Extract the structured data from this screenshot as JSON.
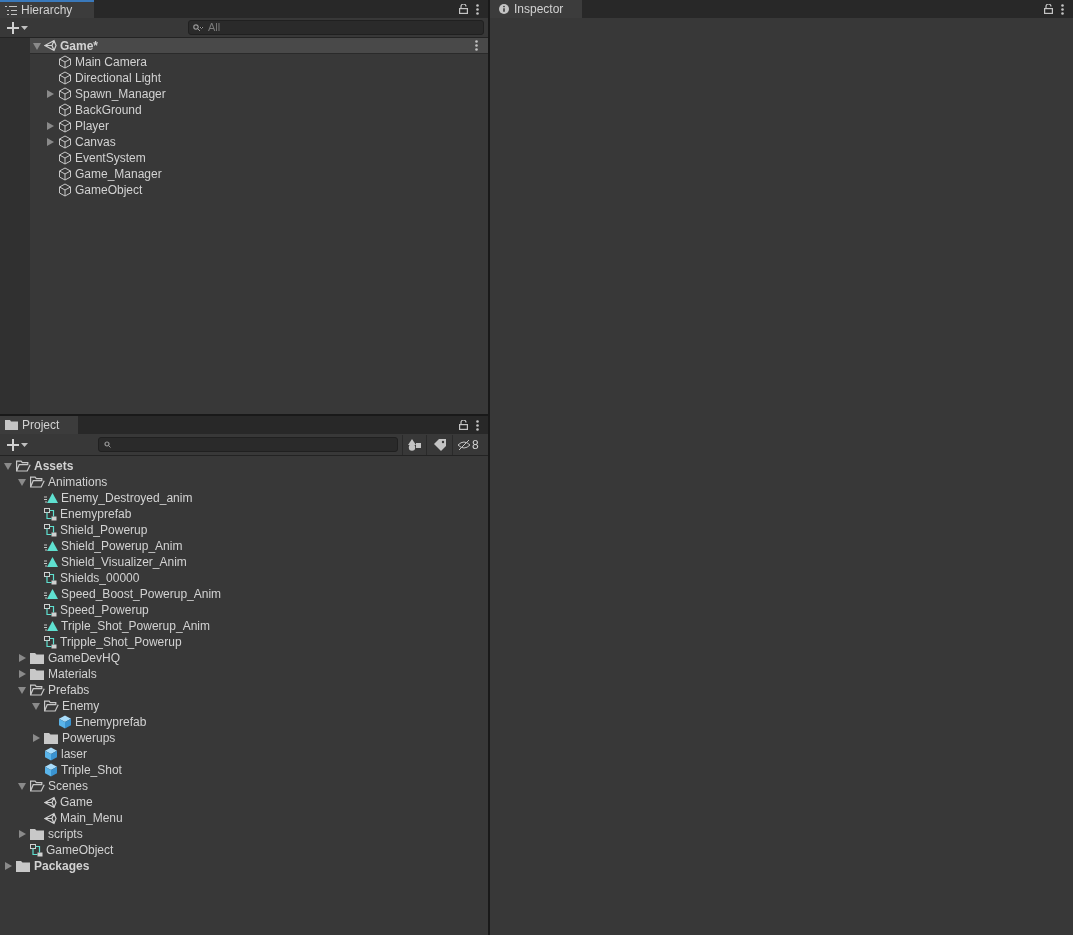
{
  "hierarchy": {
    "tab": "Hierarchy",
    "search_placeholder": "All",
    "scene": {
      "label": "Game*",
      "expanded": true,
      "children": [
        {
          "label": "Main Camera",
          "kind": "gameobject"
        },
        {
          "label": "Directional Light",
          "kind": "gameobject"
        },
        {
          "label": "Spawn_Manager",
          "kind": "gameobject",
          "expanded": false
        },
        {
          "label": "BackGround",
          "kind": "gameobject"
        },
        {
          "label": "Player",
          "kind": "gameobject",
          "expanded": false
        },
        {
          "label": "Canvas",
          "kind": "gameobject",
          "expanded": false
        },
        {
          "label": "EventSystem",
          "kind": "gameobject"
        },
        {
          "label": "Game_Manager",
          "kind": "gameobject"
        },
        {
          "label": "GameObject",
          "kind": "gameobject"
        }
      ]
    }
  },
  "project": {
    "tab": "Project",
    "hidden_count": "8",
    "tree": [
      {
        "label": "Assets",
        "kind": "folder",
        "expanded": true,
        "children": [
          {
            "label": "Animations",
            "kind": "folder",
            "expanded": true,
            "children": [
              {
                "label": "Enemy_Destroyed_anim",
                "kind": "anim"
              },
              {
                "label": "Enemyprefab",
                "kind": "controller"
              },
              {
                "label": "Shield_Powerup",
                "kind": "controller"
              },
              {
                "label": "Shield_Powerup_Anim",
                "kind": "anim"
              },
              {
                "label": "Shield_Visualizer_Anim",
                "kind": "anim"
              },
              {
                "label": "Shields_00000",
                "kind": "controller"
              },
              {
                "label": "Speed_Boost_Powerup_Anim",
                "kind": "anim"
              },
              {
                "label": "Speed_Powerup",
                "kind": "controller"
              },
              {
                "label": "Triple_Shot_Powerup_Anim",
                "kind": "anim"
              },
              {
                "label": "Tripple_Shot_Powerup",
                "kind": "controller"
              }
            ]
          },
          {
            "label": "GameDevHQ",
            "kind": "folder",
            "expanded": false
          },
          {
            "label": "Materials",
            "kind": "folder",
            "expanded": false
          },
          {
            "label": "Prefabs",
            "kind": "folder",
            "expanded": true,
            "children": [
              {
                "label": "Enemy",
                "kind": "folder",
                "expanded": true,
                "children": [
                  {
                    "label": "Enemyprefab",
                    "kind": "prefab"
                  }
                ]
              },
              {
                "label": "Powerups",
                "kind": "folder",
                "expanded": false
              },
              {
                "label": "laser",
                "kind": "prefab"
              },
              {
                "label": "Triple_Shot",
                "kind": "prefab"
              }
            ]
          },
          {
            "label": "Scenes",
            "kind": "folder",
            "expanded": true,
            "children": [
              {
                "label": "Game",
                "kind": "scene"
              },
              {
                "label": "Main_Menu",
                "kind": "scene"
              }
            ]
          },
          {
            "label": "scripts",
            "kind": "folder",
            "expanded": false
          },
          {
            "label": "GameObject",
            "kind": "controller"
          }
        ]
      },
      {
        "label": "Packages",
        "kind": "folder",
        "expanded": false
      }
    ]
  },
  "inspector": {
    "tab": "Inspector"
  }
}
